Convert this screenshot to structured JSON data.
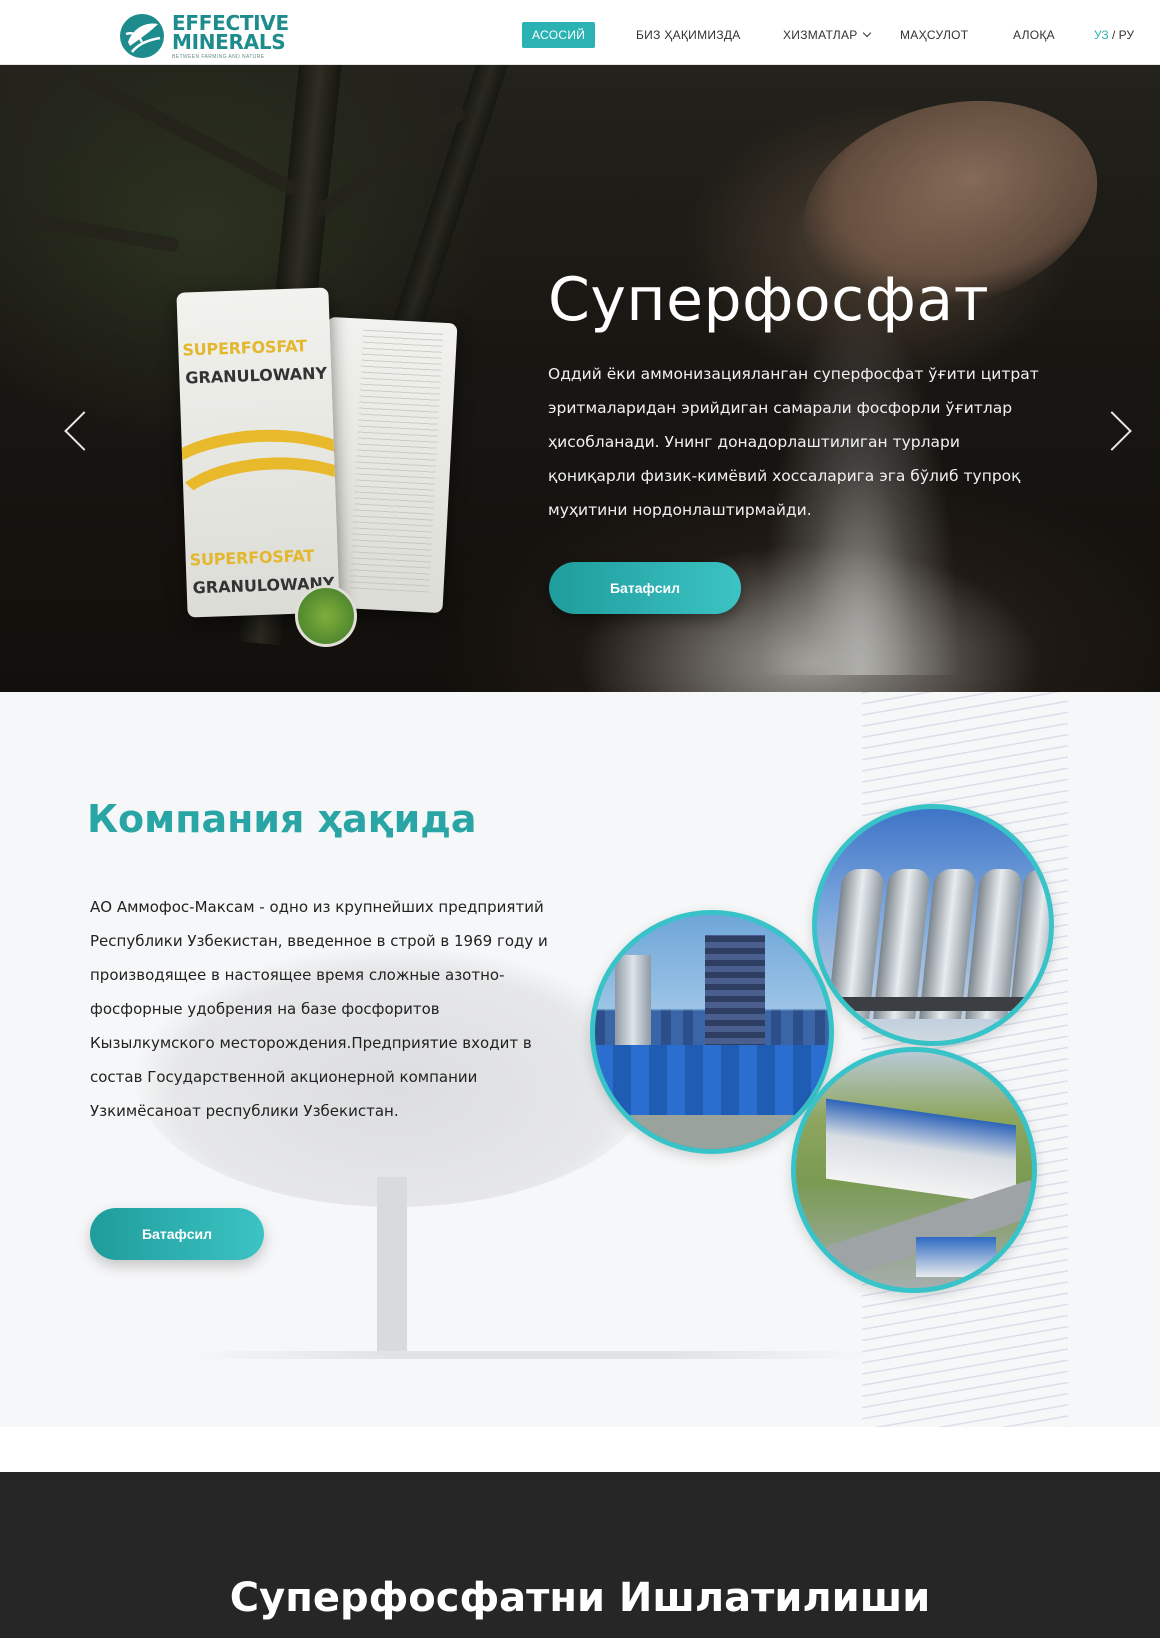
{
  "brand": {
    "line1": "EFFECTIVE",
    "line2": "MINERALS",
    "tagline": "BETWEEN FARMING AND NATURE",
    "color": "#1e8c8c"
  },
  "nav": {
    "items": [
      {
        "label": "АСОСИЙ",
        "active": true
      },
      {
        "label": "БИЗ ҲАҚИМИЗДА",
        "active": false
      },
      {
        "label": "ХИЗМАТЛАР",
        "active": false,
        "has_dropdown": true
      },
      {
        "label": "МАҲСУЛОТ",
        "active": false
      },
      {
        "label": "АЛОҚА",
        "active": false
      }
    ],
    "lang_current": "УЗ",
    "lang_separator": " / ",
    "lang_other": "РУ",
    "accent": "#2bb3b3"
  },
  "hero": {
    "title": "Суперфосфат",
    "text": "Оддий ёки аммонизацияланган суперфосфат ўғити цитрат эритмаларидан эрийдиган  самарали фосфорли ўғитлар ҳисобланади. Унинг донадорлаштилиган турлари қониқарли физик-кимёвий хоссаларига эга бўлиб тупроқ муҳитини нордонлаштирмайди.",
    "button": "Батафсил",
    "bag_label_top": "SUPERFOSFAT",
    "bag_label_sub": "GRANULOWANY",
    "bag_label_bottom": "SUPERFOSFAT",
    "bag_label_bottom_sub": "GRANULOWANY",
    "prev_icon": "chevron-left-icon",
    "next_icon": "chevron-right-icon"
  },
  "about": {
    "title": "Компания ҳақида",
    "text": "АО Аммофос-Максам - одно из крупнейших предприятий Республики Узбекистан, введенное в строй в 1969 году и производящее в настоящее время сложные азотно-фосфорные удобрения на базе фосфоритов Кызылкумского месторождения.Предприятие входит в состав Государственной акционерной компании Узкимёсаноат республики Узбекистан.",
    "button": "Батафсил",
    "title_color": "#2aa5a5",
    "ring_color": "#37c3c8"
  },
  "usage": {
    "title": "Суперфосфатни Ишлатилиши"
  }
}
